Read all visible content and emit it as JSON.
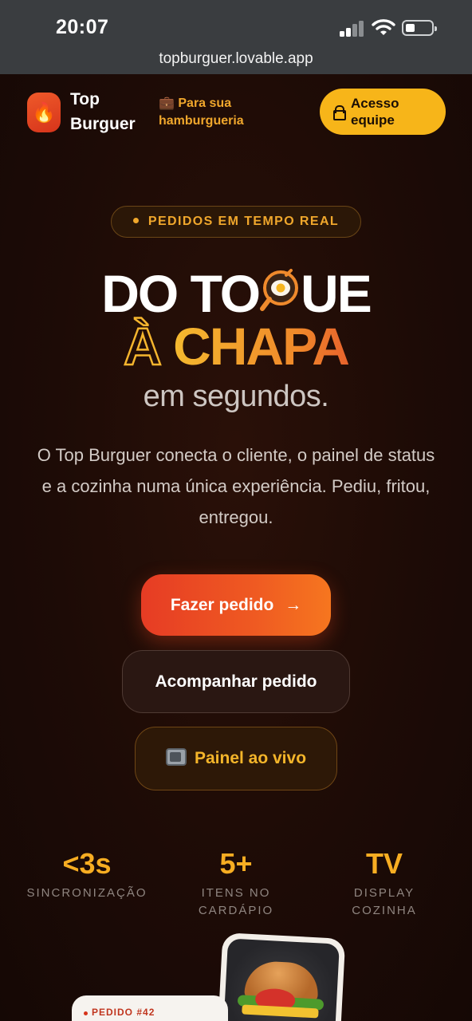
{
  "status_bar": {
    "time": "20:07"
  },
  "browser": {
    "url": "topburguer.lovable.app"
  },
  "header": {
    "brand_line1": "Top",
    "brand_line2": "Burguer",
    "for_business_emoji": "💼",
    "for_business_line1": "Para sua",
    "for_business_line2": "hamburgueria",
    "access_line1": "Acesso",
    "access_line2": "equipe"
  },
  "hero": {
    "pill": "PEDIDOS EM TEMPO REAL",
    "title_line1_a": "DO TO",
    "title_line1_b": "UE",
    "title_line2_a": "À",
    "title_line2_b": "CHAPA",
    "subtitle": "em segundos.",
    "description": "O Top Burguer conecta o cliente, o painel de status e a cozinha numa única experiência. Pediu, fritou, entregou."
  },
  "actions": {
    "order_label": "Fazer pedido",
    "order_arrow": "→",
    "track_label": "Acompanhar pedido",
    "live_label": "Painel ao vivo"
  },
  "stats": [
    {
      "value": "<3s",
      "label_line1": "SINCRONIZAÇÃO",
      "label_line2": ""
    },
    {
      "value": "5+",
      "label_line1": "ITENS NO",
      "label_line2": "CARDÁPIO"
    },
    {
      "value": "TV",
      "label_line1": "DISPLAY",
      "label_line2": "COZINHA"
    }
  ],
  "preview": {
    "order_tag": "PEDIDO #42"
  },
  "colors": {
    "accent": "#f7ad22",
    "primary": "#e63c24",
    "background": "#170906"
  },
  "icons": {
    "logo": "flame-icon",
    "access": "lock-icon",
    "live": "tv-icon",
    "title_o": "frying-pan-egg-icon"
  }
}
